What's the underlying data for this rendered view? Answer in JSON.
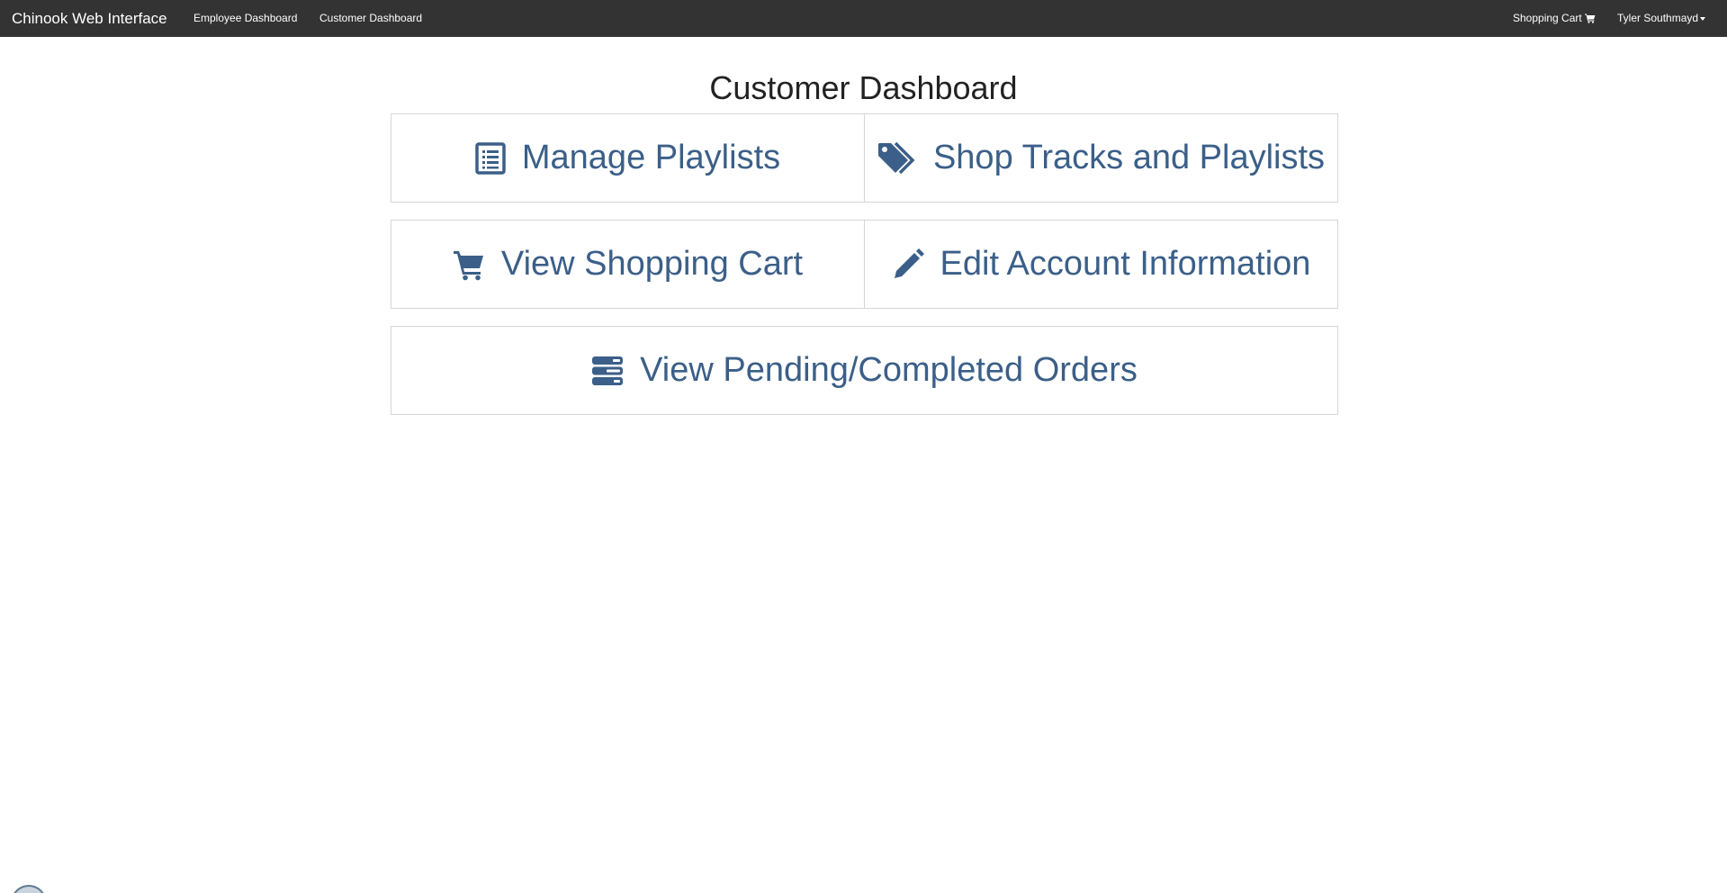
{
  "navbar": {
    "brand": "Chinook Web Interface",
    "links": [
      {
        "label": "Employee Dashboard"
      },
      {
        "label": "Customer Dashboard"
      }
    ],
    "cart_label": "Shopping Cart",
    "cart_icon": "shopping-cart-icon",
    "user_label": "Tyler Southmayd",
    "user_icon": "caret-down-icon"
  },
  "main": {
    "title": "Customer Dashboard",
    "tiles": [
      {
        "label": "Manage Playlists",
        "icon": "list-alt-icon"
      },
      {
        "label": "Shop Tracks and Playlists",
        "icon": "tags-icon"
      },
      {
        "label": "View Shopping Cart",
        "icon": "shopping-cart-icon"
      },
      {
        "label": "Edit Account Information",
        "icon": "pencil-icon"
      },
      {
        "label": "View Pending/Completed Orders",
        "icon": "tasks-icon"
      }
    ]
  },
  "colors": {
    "navbar_bg": "#333333",
    "accent": "#3b5f88",
    "tile_border": "#d6d6d6"
  }
}
